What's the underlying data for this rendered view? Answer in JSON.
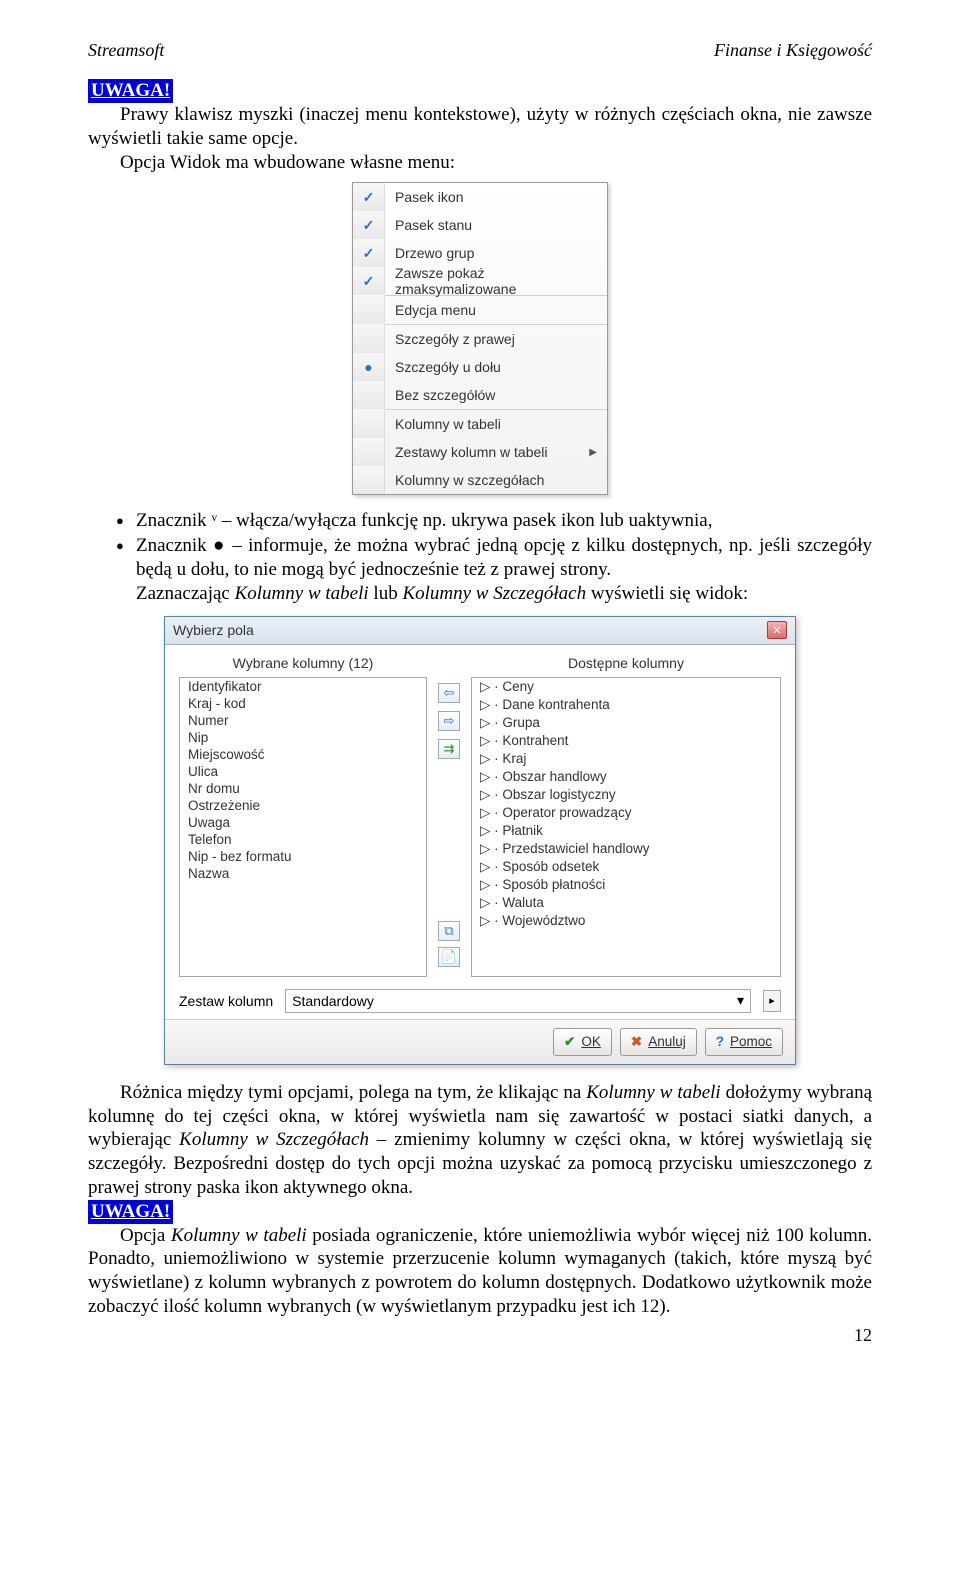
{
  "header": {
    "left": "Streamsoft",
    "right": "Finanse i Księgowość"
  },
  "uwaga": "UWAGA!",
  "para1a": "Prawy klawisz myszki (inaczej menu kontekstowe), użyty w różnych częściach okna, nie zawsze wyświetli takie same opcje.",
  "para1b": "Opcja Widok ma wbudowane własne menu:",
  "context_menu": {
    "items": [
      {
        "label": "Pasek ikon",
        "checked": true
      },
      {
        "label": "Pasek stanu",
        "checked": true
      },
      {
        "label": "Drzewo grup",
        "checked": true
      },
      {
        "label": "Zawsze pokaż zmaksymalizowane",
        "checked": true,
        "sep_after": true
      },
      {
        "label": "Edycja menu",
        "sep_after": true
      },
      {
        "label": "Szczegóły z prawej"
      },
      {
        "label": "Szczegóły u dołu",
        "radio": true
      },
      {
        "label": "Bez szczegółów",
        "sep_after": true
      },
      {
        "label": "Kolumny w tabeli"
      },
      {
        "label": "Zestawy kolumn w tabeli",
        "submenu": true
      },
      {
        "label": "Kolumny w szczegółach"
      }
    ]
  },
  "bullet1": {
    "pre": "Znacznik ",
    "glyph": "ᵛ",
    "post": " – włącza/wyłącza funkcję np. ukrywa pasek ikon lub uaktywnia,"
  },
  "bullet2": "Znacznik ● – informuje, że można wybrać jedną opcję z kilku dostępnych, np. jeśli szczegóły będą u dołu, to nie mogą być jednocześnie też z prawej strony.",
  "para2_pre": "Zaznaczając ",
  "para2_em1": "Kolumny w tabeli",
  "para2_mid": " lub ",
  "para2_em2": "Kolumny w Szczegółach",
  "para2_post": " wyświetli się widok:",
  "dialog": {
    "title": "Wybierz pola",
    "left_header": "Wybrane kolumny (12)",
    "right_header": "Dostępne kolumny",
    "left_items": [
      "Identyfikator",
      "Kraj - kod",
      "Numer",
      "Nip",
      "Miejscowość",
      "Ulica",
      "Nr domu",
      "Ostrzeżenie",
      "Uwaga",
      "Telefon",
      "Nip - bez formatu",
      "Nazwa"
    ],
    "right_items": [
      "Ceny",
      "Dane kontrahenta",
      "Grupa",
      "Kontrahent",
      "Kraj",
      "Obszar handlowy",
      "Obszar logistyczny",
      "Operator prowadzący",
      "Płatnik",
      "Przedstawiciel handlowy",
      "Sposób odsetek",
      "Sposób płatności",
      "Waluta",
      "Województwo"
    ],
    "set_label": "Zestaw kolumn",
    "set_value": "Standardowy",
    "ok": "OK",
    "cancel": "Anuluj",
    "help": "Pomoc"
  },
  "para3": {
    "t1": "Różnica między tymi opcjami, polega na tym, że klikając na ",
    "e1": "Kolumny w tabeli",
    "t2": " dołożymy wybraną kolumnę do tej części okna, w której wyświetla nam się zawartość w postaci siatki danych, a wybierając ",
    "e2": "Kolumny w Szczegółach",
    "t3": " – zmienimy kolumny w części okna, w której wyświetlają się szczegóły. Bezpośredni dostęp do tych opcji można uzyskać za pomocą przycisku umieszczonego z prawej strony paska ikon aktywnego okna."
  },
  "para4": {
    "t1": "Opcja ",
    "e1": "Kolumny w tabeli",
    "t2": " posiada ograniczenie, które uniemożliwia wybór więcej niż 100 kolumn. Ponadto, uniemożliwiono w systemie przerzucenie kolumn wymaganych (takich, które myszą być wyświetlane) z kolumn wybranych z powrotem do kolumn dostępnych. Dodatkowo użytkownik może zobaczyć ilość kolumn wybranych (w wyświetlanym przypadku jest ich 12)."
  },
  "page_number": "12"
}
